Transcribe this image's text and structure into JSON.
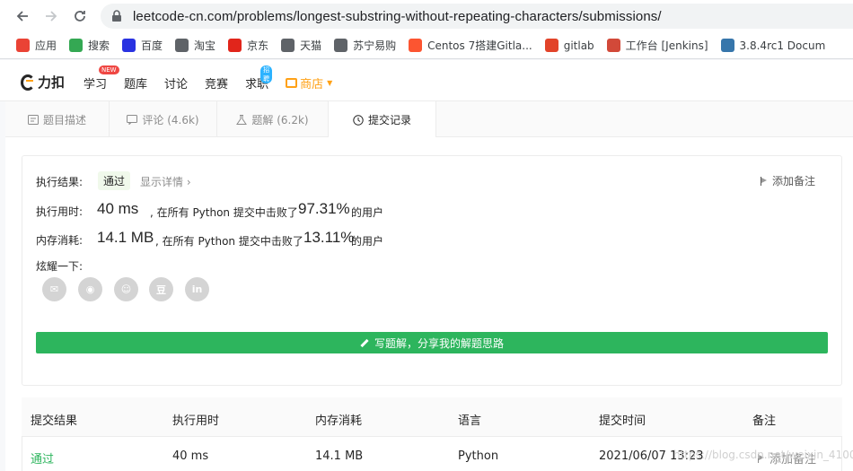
{
  "browser": {
    "url": "leetcode-cn.com/problems/longest-substring-without-repeating-characters/submissions/",
    "bookmarks": [
      {
        "label": "应用",
        "icon": "apps-grid-icon",
        "color": "#ea4335"
      },
      {
        "label": "搜索",
        "icon": "search-engine-icon",
        "color": "#34a853"
      },
      {
        "label": "百度",
        "icon": "baidu-paw-icon",
        "color": "#2932e1"
      },
      {
        "label": "淘宝",
        "icon": "globe-icon",
        "color": "#5f6368"
      },
      {
        "label": "京东",
        "icon": "jd-logo-icon",
        "color": "#e1251b"
      },
      {
        "label": "天猫",
        "icon": "globe-icon",
        "color": "#5f6368"
      },
      {
        "label": "苏宁易购",
        "icon": "globe-icon",
        "color": "#5f6368"
      },
      {
        "label": "Centos 7搭建Gitla...",
        "icon": "csdn-c-icon",
        "color": "#fc5531"
      },
      {
        "label": "gitlab",
        "icon": "gitlab-fox-icon",
        "color": "#e24329"
      },
      {
        "label": "工作台 [Jenkins]",
        "icon": "jenkins-icon",
        "color": "#d24939"
      },
      {
        "label": "3.8.4rc1 Docum",
        "icon": "python-icon",
        "color": "#3776ab"
      }
    ]
  },
  "site": {
    "logo_text": "力扣",
    "nav": [
      {
        "label": "学习",
        "badge": "NEW"
      },
      {
        "label": "题库"
      },
      {
        "label": "讨论"
      },
      {
        "label": "竞赛"
      },
      {
        "label": "求职",
        "badge": "招聘"
      },
      {
        "label": "商店"
      }
    ],
    "shop_label": "商店",
    "accent_color": "#ffa116"
  },
  "tabs": [
    {
      "label": "题目描述",
      "icon": "document-icon"
    },
    {
      "label": "评论 (4.6k)",
      "icon": "comment-icon"
    },
    {
      "label": "题解 (6.2k)",
      "icon": "flask-icon"
    },
    {
      "label": "提交记录",
      "icon": "clock-icon",
      "active": true
    }
  ],
  "result": {
    "status_label": "执行结果:",
    "status_value": "通过",
    "detail_link": "显示详情 ›",
    "add_note": "添加备注",
    "runtime_label": "执行用时:",
    "runtime_value": "40 ms",
    "runtime_text": ", 在所有 Python 提交中击败了",
    "runtime_pct": "97.31%",
    "runtime_suffix": "的用户",
    "memory_label": "内存消耗:",
    "memory_value": "14.1 MB",
    "memory_text": ", 在所有 Python 提交中击败了",
    "memory_pct": "13.11%",
    "memory_suffix": "的用户",
    "share_label": "炫耀一下:",
    "share_icons": [
      "wechat-icon",
      "weibo-icon",
      "qq-icon",
      "douban-icon",
      "linkedin-icon"
    ],
    "share_glyphs": [
      "✉",
      "◉",
      "☺",
      "豆",
      "in"
    ],
    "solve_button": "写题解，分享我的解题思路",
    "success_color": "#2db55d"
  },
  "table": {
    "headers": [
      "提交结果",
      "执行用时",
      "内存消耗",
      "语言",
      "提交时间",
      "备注"
    ],
    "rows": [
      {
        "result": "通过",
        "runtime": "40 ms",
        "memory": "14.1 MB",
        "language": "Python",
        "time": "2021/06/07 13:23",
        "note": "添加备注"
      }
    ]
  },
  "watermark": "https://blog.csdn.net/weixin_4100"
}
